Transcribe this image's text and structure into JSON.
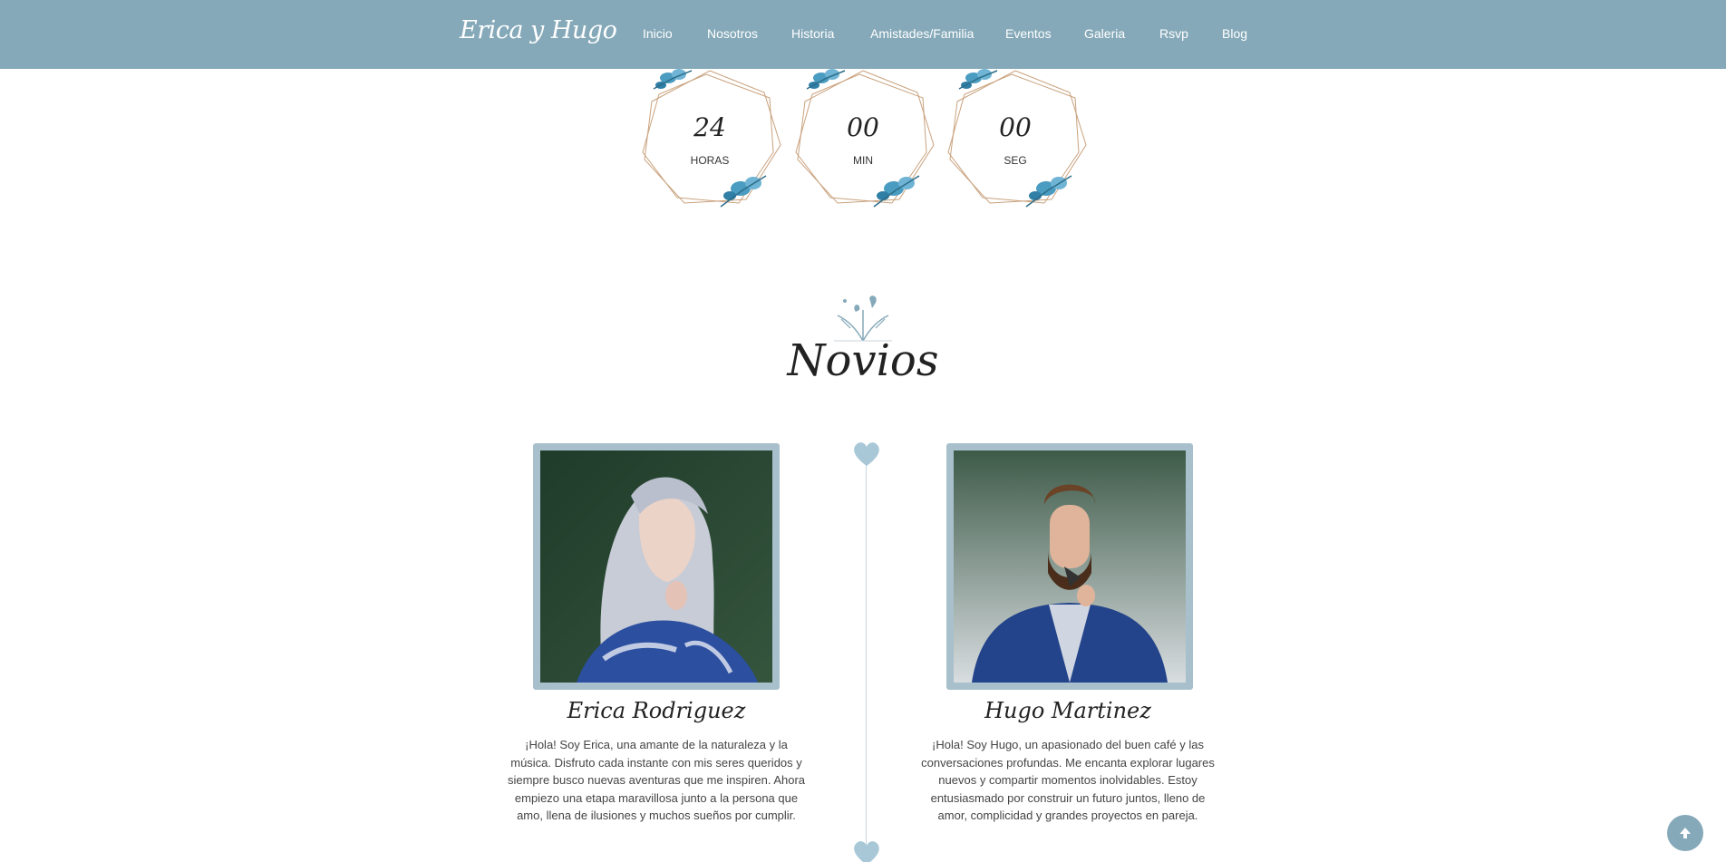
{
  "header": {
    "brand": "Erica y Hugo",
    "nav": [
      "Inicio",
      "Nosotros",
      "Historia",
      "Amistades/Familia",
      "Eventos",
      "Galeria",
      "Rsvp",
      "Blog"
    ]
  },
  "countdown": [
    {
      "value": "24",
      "unit": "HORAS"
    },
    {
      "value": "00",
      "unit": "MIN"
    },
    {
      "value": "00",
      "unit": "SEG"
    }
  ],
  "section": {
    "title": "Novios"
  },
  "bride": {
    "name": "Erica Rodriguez",
    "bio": "¡Hola! Soy Erica, una amante de la naturaleza y la música. Disfruto cada instante con mis seres queridos y siempre busco nuevas aventuras que me inspiren. Ahora empiezo una etapa maravillosa junto a la persona que amo, llena de ilusiones y muchos sueños por cumplir."
  },
  "groom": {
    "name": "Hugo Martinez",
    "bio": "¡Hola! Soy Hugo, un apasionado del buen café y las conversaciones profundas. Me encanta explorar lugares nuevos y compartir momentos inolvidables. Estoy entusiasmado por construir un futuro juntos, lleno de amor, complicidad y grandes proyectos en pareja."
  },
  "colors": {
    "header_bg": "#85a9b9",
    "accent": "#a8c0cc",
    "frame_gold": "#c9a27e",
    "flower_blue": "#4a9cc0"
  },
  "icons": {
    "scroll_top": "arrow-up-icon",
    "divider": "heart-icon"
  }
}
